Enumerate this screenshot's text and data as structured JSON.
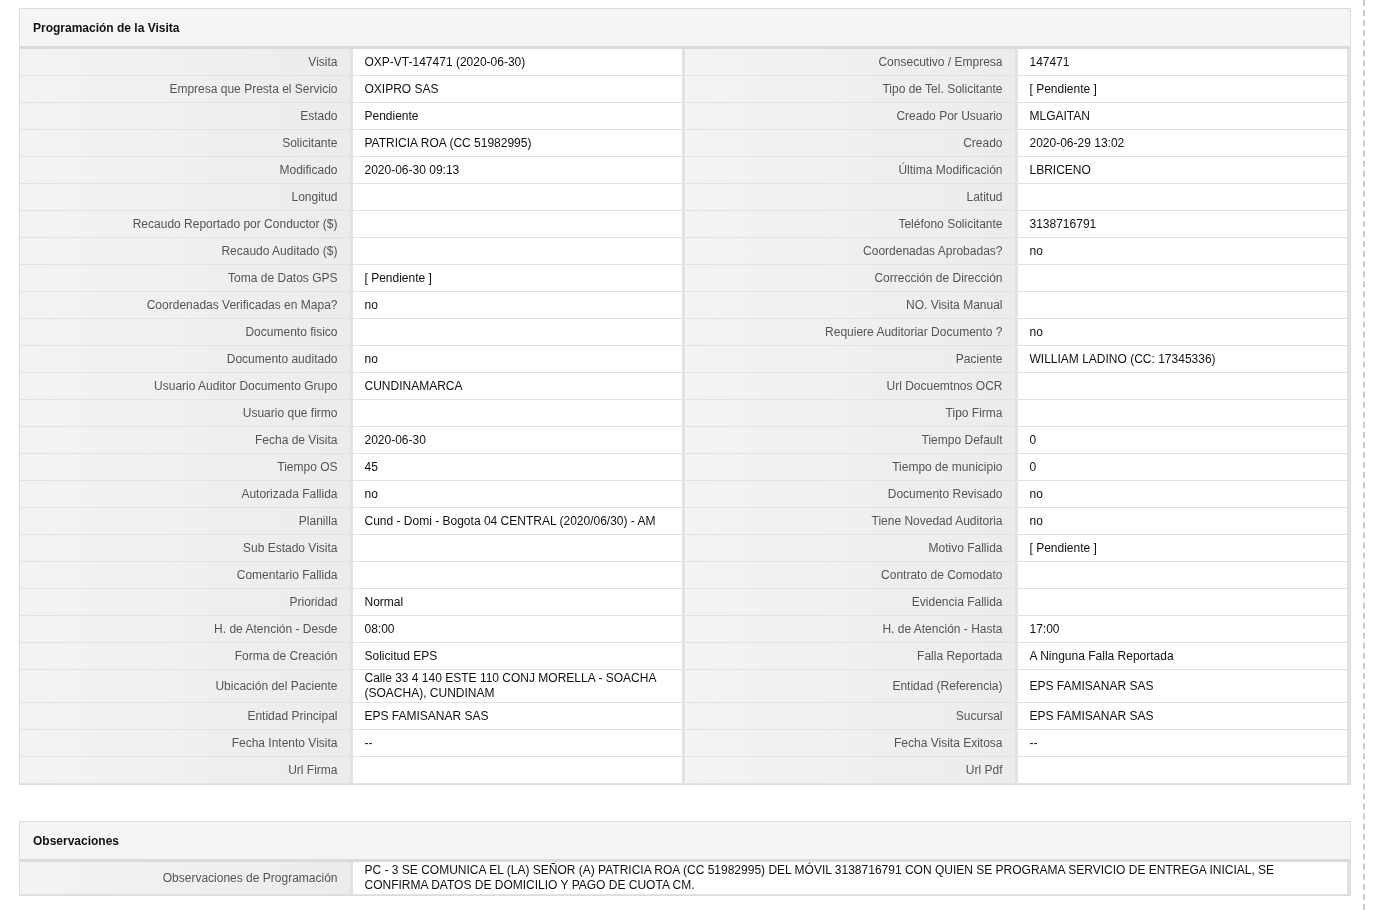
{
  "sections": [
    {
      "title": "Programación de la Visita",
      "rows": [
        [
          {
            "label": "Visita",
            "value": "OXP-VT-147471 (2020-06-30)"
          },
          {
            "label": "Consecutivo / Empresa",
            "value": "147471"
          }
        ],
        [
          {
            "label": "Empresa que Presta el Servicio",
            "value": "OXIPRO SAS"
          },
          {
            "label": "Tipo de Tel. Solicitante",
            "value": "[ Pendiente ]"
          }
        ],
        [
          {
            "label": "Estado",
            "value": "Pendiente"
          },
          {
            "label": "Creado Por Usuario",
            "value": "MLGAITAN"
          }
        ],
        [
          {
            "label": "Solicitante",
            "value": "PATRICIA ROA (CC 51982995)"
          },
          {
            "label": "Creado",
            "value": "2020-06-29 13:02"
          }
        ],
        [
          {
            "label": "Modificado",
            "value": "2020-06-30 09:13"
          },
          {
            "label": "Última Modificación",
            "value": "LBRICENO"
          }
        ],
        [
          {
            "label": "Longitud"
          },
          {
            "label": "Latitud"
          }
        ],
        [
          {
            "label": "Recaudo Reportado por Conductor ($)"
          },
          {
            "label": "Teléfono Solicitante",
            "value": "3138716791"
          }
        ],
        [
          {
            "label": "Recaudo Auditado ($)"
          },
          {
            "label": "Coordenadas Aprobadas?",
            "value": "no"
          }
        ],
        [
          {
            "label": "Toma de Datos GPS",
            "value": "[ Pendiente ]"
          },
          {
            "label": "Corrección de Dirección"
          }
        ],
        [
          {
            "label": "Coordenadas Verificadas en Mapa?",
            "value": "no"
          },
          {
            "label": "NO. Visita Manual"
          }
        ],
        [
          {
            "label": "Documento fisico"
          },
          {
            "label": "Requiere Auditoriar Documento ?",
            "value": "no"
          }
        ],
        [
          {
            "label": "Documento auditado",
            "value": "no"
          },
          {
            "label": "Paciente",
            "value": "WILLIAM LADINO (CC: 17345336)"
          }
        ],
        [
          {
            "label": "Usuario Auditor Documento Grupo",
            "value": "CUNDINAMARCA"
          },
          {
            "label": "Url Docuemtnos OCR"
          }
        ],
        [
          {
            "label": "Usuario que firmo"
          },
          {
            "label": "Tipo Firma"
          }
        ],
        [
          {
            "label": "Fecha de Visita",
            "value": "2020-06-30"
          },
          {
            "label": "Tiempo Default",
            "value": "0"
          }
        ],
        [
          {
            "label": "Tiempo OS",
            "value": "45"
          },
          {
            "label": "Tiempo de municipio",
            "value": "0"
          }
        ],
        [
          {
            "label": "Autorizada Fallida",
            "value": "no"
          },
          {
            "label": "Documento Revisado",
            "value": "no"
          }
        ],
        [
          {
            "label": "Planilla",
            "value": "Cund - Domi - Bogota 04 CENTRAL (2020/06/30) - AM"
          },
          {
            "label": "Tiene Novedad Auditoria",
            "value": "no"
          }
        ],
        [
          {
            "label": "Sub Estado Visita"
          },
          {
            "label": "Motivo Fallida",
            "value": "[ Pendiente ]"
          }
        ],
        [
          {
            "label": "Comentario Fallida"
          },
          {
            "label": "Contrato de Comodato"
          }
        ],
        [
          {
            "label": "Prioridad",
            "value": "Normal"
          },
          {
            "label": "Evidencia Fallida"
          }
        ],
        [
          {
            "label": "H. de Atención - Desde",
            "value": "08:00"
          },
          {
            "label": "H. de Atención - Hasta",
            "value": "17:00"
          }
        ],
        [
          {
            "label": "Forma de Creación",
            "value": "Solicitud EPS"
          },
          {
            "label": "Falla Reportada",
            "value": "A Ninguna Falla Reportada"
          }
        ],
        [
          {
            "label": "Ubicación del Paciente",
            "value": "Calle 33 4 140 ESTE 110 CONJ MORELLA - SOACHA (SOACHA), CUNDINAM"
          },
          {
            "label": "Entidad (Referencia)",
            "value": "EPS FAMISANAR SAS"
          }
        ],
        [
          {
            "label": "Entidad Principal",
            "value": "EPS FAMISANAR SAS"
          },
          {
            "label": "Sucursal",
            "value": "EPS FAMISANAR SAS"
          }
        ],
        [
          {
            "label": "Fecha Intento Visita",
            "value": "--"
          },
          {
            "label": "Fecha Visita Exitosa",
            "value": "--"
          }
        ],
        [
          {
            "label": "Url Firma"
          },
          {
            "label": "Url Pdf"
          }
        ]
      ]
    },
    {
      "title": "Observaciones",
      "rows": [
        [
          {
            "label": "Observaciones de Programación",
            "value": "PC - 3 SE COMUNICA EL (LA) SEÑOR (A) PATRICIA ROA (CC 51982995) DEL MÓVIL 3138716791 CON QUIEN SE PROGRAMA SERVICIO DE ENTREGA INICIAL, SE CONFIRMA DATOS DE DOMICILIO Y PAGO DE CUOTA CM."
          }
        ]
      ]
    }
  ]
}
